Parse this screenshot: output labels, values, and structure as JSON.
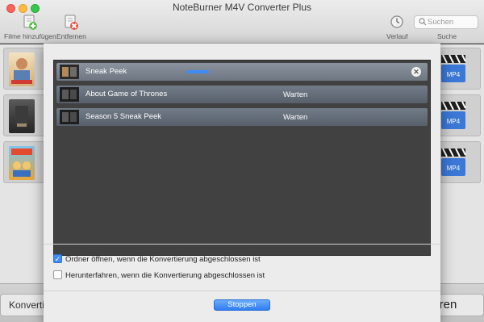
{
  "window": {
    "title": "NoteBurner M4V Converter Plus"
  },
  "toolbar": {
    "add_label": "Filme hinzufügen",
    "remove_label": "Entfernen",
    "history_label": "Verlauf",
    "search_label": "Suche",
    "search_placeholder": "Suchen"
  },
  "background": {
    "convert_left_label": "Konvertie",
    "convert_right_label": "ieren"
  },
  "dialog": {
    "tasks": [
      {
        "name": "Sneak Peek",
        "status": "",
        "progress_percent": 10
      },
      {
        "name": "About Game of Thrones",
        "status": "Warten"
      },
      {
        "name": "Season 5 Sneak Peek",
        "status": "Warten"
      }
    ],
    "option_open_folder": {
      "label": "Ordner öffnen, wenn die Konvertierung abgeschlossen ist",
      "checked": true
    },
    "option_shutdown": {
      "label": "Herunterfahren, wenn die Konvertierung abgeschlossen ist",
      "checked": false
    },
    "stop_label": "Stoppen",
    "cancel_symbol": "✕",
    "check_symbol": "✓"
  },
  "colors": {
    "accent": "#3f8cf6",
    "progress": "#3f8cf6"
  },
  "icons": {
    "add": "film-add-icon",
    "remove": "film-remove-icon",
    "history": "clock-icon",
    "search": "search-icon",
    "output": "mp4-clapper-icon"
  }
}
